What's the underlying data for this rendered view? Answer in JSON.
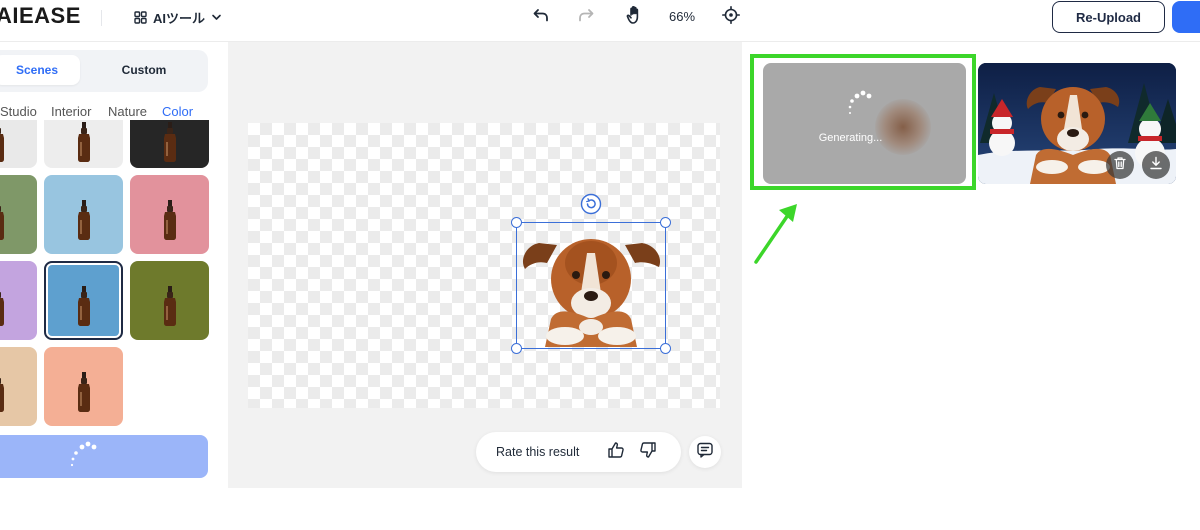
{
  "app": {
    "logo_text": "AIEASE"
  },
  "header": {
    "tools_menu_label": "AIツール",
    "zoom_label": "66%",
    "reupload_label": "Re-Upload",
    "icons": [
      "grid-icon",
      "chevron-down-icon",
      "undo-icon",
      "redo-icon",
      "hand-icon",
      "crosshair-icon"
    ]
  },
  "left_panel": {
    "tabs": [
      {
        "label": "Scenes",
        "active": true
      },
      {
        "label": "Custom",
        "active": false
      }
    ],
    "categories": [
      {
        "label": "Studio",
        "active": false
      },
      {
        "label": "Interior",
        "active": false
      },
      {
        "label": "Nature",
        "active": false
      },
      {
        "label": "Color",
        "active": true
      }
    ],
    "scene_colors": [
      "#e9e9e9",
      "#ededed",
      "#262626",
      "#7f9868",
      "#98c5e0",
      "#e2929c",
      "#c3a4df",
      "#5ea0cf",
      "#6e7a2c",
      "#e6c7a6",
      "#f4af95"
    ],
    "selected_scene_index": 7
  },
  "canvas": {
    "rate_label": "Rate this result",
    "icons": [
      "rotate-icon",
      "thumbs-up-icon",
      "thumbs-down-icon",
      "feedback-icon"
    ]
  },
  "results": {
    "generating_label": "Generating...",
    "highlight_color": "#3cd62a",
    "icons": [
      "delete-icon",
      "download-icon"
    ]
  }
}
